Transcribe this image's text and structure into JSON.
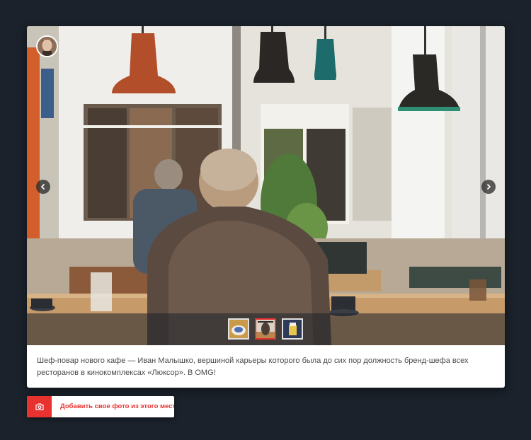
{
  "photo": {
    "description_alt": "Пожилой мужчина сидит за столом в кафе у окна"
  },
  "gallery": {
    "thumbnails": [
      {
        "name": "thumbnail-1",
        "active": false
      },
      {
        "name": "thumbnail-2",
        "active": true
      },
      {
        "name": "thumbnail-3",
        "active": false
      }
    ]
  },
  "caption": "Шеф-повар нового кафе — Иван Малышко, вершиной карьеры которого была до сих пор должность бренд-шефа всех ресторанов в кинокомплексах «Люксор». В OMG!",
  "add_photo": {
    "label": "Добавить свое фото из этого места"
  },
  "colors": {
    "accent": "#e8322f",
    "page_bg": "#1b222b",
    "card_bg": "#ffffff"
  },
  "icons": {
    "prev": "chevron-left-icon",
    "next": "chevron-right-icon",
    "add": "camera-icon"
  }
}
